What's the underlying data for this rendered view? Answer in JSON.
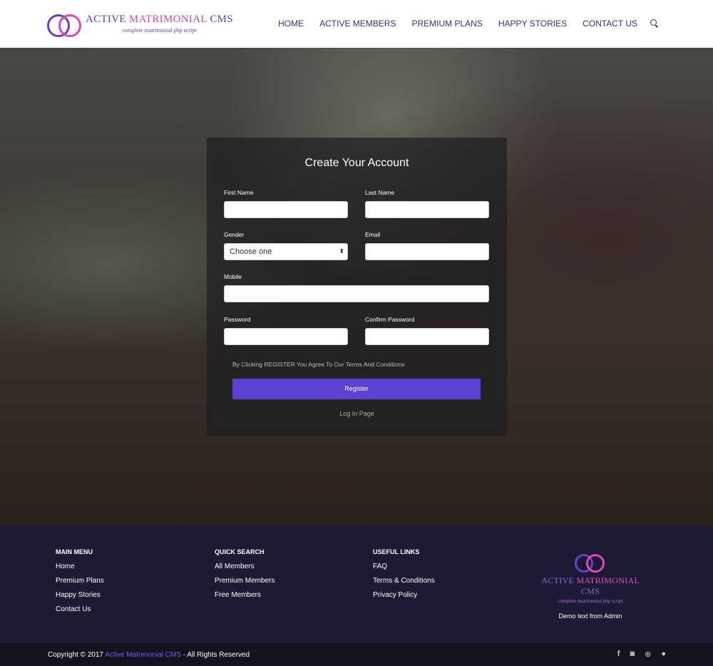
{
  "brand": {
    "name_part1": "ACTIVE",
    "name_part2": "MATRIMONIAL",
    "name_part3": "CMS",
    "tagline": "complete matrimonial php script"
  },
  "nav": [
    {
      "label": "HOME"
    },
    {
      "label": "ACTIVE MEMBERS"
    },
    {
      "label": "PREMIUM PLANS"
    },
    {
      "label": "HAPPY STORIES"
    },
    {
      "label": "CONTACT US"
    }
  ],
  "form": {
    "title": "Create Your Account",
    "first_name": "First Name",
    "last_name": "Last Name",
    "gender": "Gender",
    "gender_value": "Choose one",
    "email": "Email",
    "mobile": "Mobile",
    "password": "Password",
    "confirm_password": "Confirm Password",
    "terms": "By Clicking REGISTER You Agree To Our Terms And Conditions",
    "register": "Register",
    "login": "Log In Page"
  },
  "footer": {
    "main_menu": {
      "title": "MAIN MENU",
      "items": [
        "Home",
        "Premium Plans",
        "Happy Stories",
        "Contact Us"
      ]
    },
    "quick_search": {
      "title": "QUICK SEARCH",
      "items": [
        "All Members",
        "Premium Members",
        "Free Members"
      ]
    },
    "useful_links": {
      "title": "USEFUL LINKS",
      "items": [
        "FAQ",
        "Terms & Conditions",
        "Privacy Policy"
      ]
    },
    "demo_text": "Demo text from Admin",
    "copyright_prefix": "Copyright © 2017 ",
    "copyright_link": "Active Matrimonial CMS",
    "copyright_suffix": " - All Rights Reserved",
    "social": [
      "facebook-icon",
      "instagram-icon",
      "dribbble-icon",
      "github-icon"
    ]
  },
  "colors": {
    "accent": "#5d3fd3",
    "footer_bg": "#1d1a35"
  }
}
